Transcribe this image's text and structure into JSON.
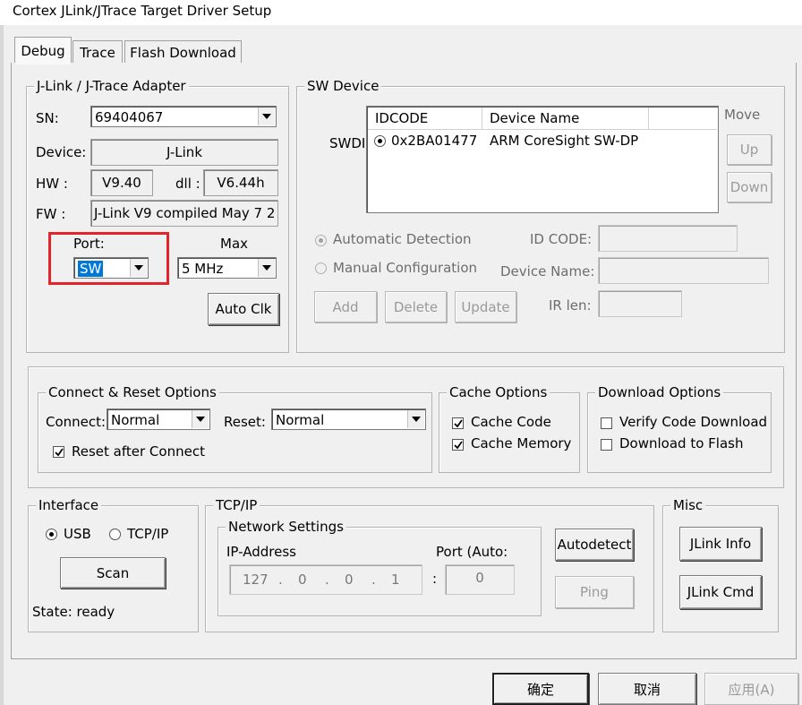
{
  "window": {
    "title": "Cortex JLink/JTrace Target Driver Setup"
  },
  "tabs": [
    {
      "label": "Debug",
      "active": true
    },
    {
      "label": "Trace",
      "active": false
    },
    {
      "label": "Flash Download",
      "active": false
    }
  ],
  "adapter": {
    "title": "J-Link / J-Trace Adapter",
    "sn_label": "SN:",
    "sn_value": "69404067",
    "device_label": "Device:",
    "device_value": "J-Link",
    "hw_label": "HW :",
    "hw_value": "V9.40",
    "dll_label": "dll :",
    "dll_value": "V6.44h",
    "fw_label": "FW :",
    "fw_value": "J-Link V9 compiled May  7 2",
    "port_label": "Port:",
    "port_value": "SW",
    "max_label": "Max",
    "max_value": "5 MHz",
    "auto_clk_label": "Auto Clk"
  },
  "sw_device": {
    "title": "SW Device",
    "swdi_label": "SWDI",
    "columns": [
      "IDCODE",
      "Device Name"
    ],
    "rows": [
      {
        "idcode": "0x2BA01477",
        "name": "ARM CoreSight SW-DP"
      }
    ],
    "move_label": "Move",
    "up_label": "Up",
    "down_label": "Down",
    "auto_detect_label": "Automatic Detection",
    "manual_config_label": "Manual Configuration",
    "id_code_label": "ID CODE:",
    "device_name_label": "Device Name:",
    "ir_len_label": "IR len:",
    "add_label": "Add",
    "delete_label": "Delete",
    "update_label": "Update"
  },
  "connect_reset": {
    "title": "Connect & Reset Options",
    "connect_label": "Connect:",
    "connect_value": "Normal",
    "reset_label": "Reset:",
    "reset_value": "Normal",
    "reset_after_connect_label": "Reset after Connect",
    "reset_after_connect_checked": true
  },
  "cache_options": {
    "title": "Cache Options",
    "cache_code_label": "Cache Code",
    "cache_code_checked": true,
    "cache_memory_label": "Cache Memory",
    "cache_memory_checked": true
  },
  "download_options": {
    "title": "Download Options",
    "verify_label": "Verify Code Download",
    "verify_checked": false,
    "flash_label": "Download to Flash",
    "flash_checked": false
  },
  "interface": {
    "title": "Interface",
    "usb_label": "USB",
    "tcpip_label": "TCP/IP",
    "selected": "USB",
    "scan_label": "Scan",
    "state_text": "State: ready"
  },
  "tcpip": {
    "title": "TCP/IP",
    "network_title": "Network Settings",
    "ip_label": "IP-Address",
    "ip_octets": [
      "127",
      "0",
      "0",
      "1"
    ],
    "port_label": "Port (Auto:",
    "port_value": "0",
    "autodetect_label": "Autodetect",
    "ping_label": "Ping"
  },
  "misc": {
    "title": "Misc",
    "jlink_info_label": "JLink Info",
    "jlink_cmd_label": "JLink Cmd"
  },
  "footer": {
    "ok_label": "确定",
    "cancel_label": "取消",
    "apply_label": "应用(A)"
  },
  "colors": {
    "highlight": "#e3242b",
    "selection": "#0078d7"
  }
}
